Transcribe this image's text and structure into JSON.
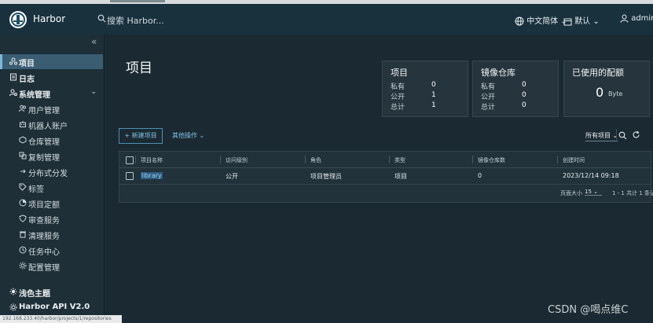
{
  "header": {
    "brand": "Harbor",
    "search_placeholder": "搜索 Harbor...",
    "language": "中文简体",
    "theme_default": "默认",
    "user": "admin"
  },
  "sidebar": {
    "collapse_label": "«",
    "items": [
      {
        "label": "项目",
        "icon": "projects-icon"
      },
      {
        "label": "日志",
        "icon": "logs-icon"
      },
      {
        "label": "系统管理",
        "icon": "admin-icon"
      }
    ],
    "admin_subitems": [
      {
        "label": "用户管理",
        "icon": "users-icon"
      },
      {
        "label": "机器人账户",
        "icon": "robot-icon"
      },
      {
        "label": "仓库管理",
        "icon": "registry-icon"
      },
      {
        "label": "复制管理",
        "icon": "replication-icon"
      },
      {
        "label": "分布式分发",
        "icon": "distribution-icon"
      },
      {
        "label": "标签",
        "icon": "tag-icon"
      },
      {
        "label": "项目定额",
        "icon": "quota-icon"
      },
      {
        "label": "审查服务",
        "icon": "shield-icon"
      },
      {
        "label": "清理服务",
        "icon": "trash-icon"
      },
      {
        "label": "任务中心",
        "icon": "clock-icon"
      },
      {
        "label": "配置管理",
        "icon": "config-icon"
      }
    ],
    "theme_toggle": "浅色主题",
    "api": "Harbor API V2.0"
  },
  "main": {
    "title": "项目",
    "cards": {
      "projects": {
        "title": "项目",
        "rows": [
          {
            "label": "私有",
            "value": "0"
          },
          {
            "label": "公开",
            "value": "1"
          },
          {
            "label": "总计",
            "value": "1"
          }
        ]
      },
      "repos": {
        "title": "镜像仓库",
        "rows": [
          {
            "label": "私有",
            "value": "0"
          },
          {
            "label": "公开",
            "value": "0"
          },
          {
            "label": "总计",
            "value": "0"
          }
        ]
      },
      "quota": {
        "title": "已使用的配额",
        "value": "0",
        "unit": "Byte"
      }
    },
    "toolbar": {
      "new_project": "+ 新建项目",
      "other_actions": "其他操作",
      "filter": "所有项目"
    },
    "table": {
      "columns": [
        "项目名称",
        "访问级别",
        "角色",
        "类型",
        "镜像仓库数",
        "创建时间"
      ],
      "rows": [
        {
          "name": "library",
          "access": "公开",
          "role": "项目管理员",
          "type": "项目",
          "repo_count": "0",
          "created": "2023/12/14 09:18"
        }
      ],
      "page_size_label": "页面大小",
      "page_size": "15",
      "range": "1 - 1 共计 1 条记录"
    }
  },
  "status_url": "192.168.233.40/harbor/projects/1/repositories",
  "watermark": "CSDN @喝点维C"
}
